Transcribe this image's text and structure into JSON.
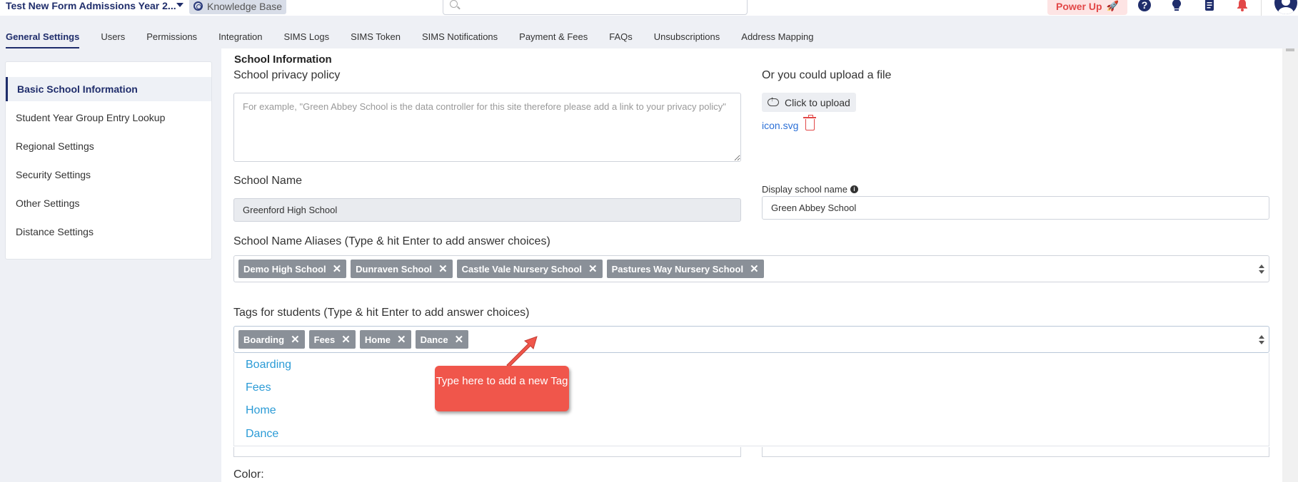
{
  "header": {
    "app_title": "Test New Form Admissions Year 2...",
    "knowledge_base": "Knowledge Base",
    "power_up": "Power Up",
    "power_up_glyph": "🚀",
    "icons": [
      "question-circle-icon",
      "lightbulb-icon",
      "document-icon",
      "bell-icon",
      "user-avatar-icon"
    ]
  },
  "tabs": [
    {
      "label": "General Settings",
      "active": true
    },
    {
      "label": "Users"
    },
    {
      "label": "Permissions"
    },
    {
      "label": "Integration"
    },
    {
      "label": "SIMS Logs"
    },
    {
      "label": "SIMS Token"
    },
    {
      "label": "SIMS Notifications"
    },
    {
      "label": "Payment & Fees"
    },
    {
      "label": "FAQs"
    },
    {
      "label": "Unsubscriptions"
    },
    {
      "label": "Address Mapping"
    }
  ],
  "sidebar": {
    "items": [
      {
        "label": "Basic School Information",
        "active": true
      },
      {
        "label": "Student Year Group Entry Lookup"
      },
      {
        "label": "Regional Settings"
      },
      {
        "label": "Security Settings"
      },
      {
        "label": "Other Settings"
      },
      {
        "label": "Distance Settings"
      }
    ]
  },
  "form": {
    "section_title": "School Information",
    "privacy_label": "School privacy policy",
    "privacy_placeholder": "For example, \"Green Abbey School is the data controller for this site therefore please add a link to your privacy policy\"",
    "upload_label": "Or you could upload a file",
    "upload_button": "Click to upload",
    "uploaded_file": "icon.svg",
    "school_name_label": "School Name",
    "school_name_value": "Greenford High School",
    "display_name_label": "Display school name",
    "display_name_value": "Green Abbey School",
    "aliases_label": "School Name Aliases (Type & hit Enter to add answer choices)",
    "aliases": [
      "Demo High School",
      "Dunraven School",
      "Castle Vale Nursery School",
      "Pastures Way Nursery School"
    ],
    "tags_label": "Tags for students (Type & hit Enter to add answer choices)",
    "tags": [
      "Boarding",
      "Fees",
      "Home",
      "Dance"
    ],
    "tag_options": [
      "Boarding",
      "Fees",
      "Home",
      "Dance"
    ],
    "color_label": "Color:"
  },
  "annotation": {
    "callout_text": "Type here to add a new Tag"
  },
  "colors": {
    "accent": "#1f2d6b",
    "callout": "#f0564b",
    "chip": "#8a9098",
    "link": "#2b6fd6"
  }
}
